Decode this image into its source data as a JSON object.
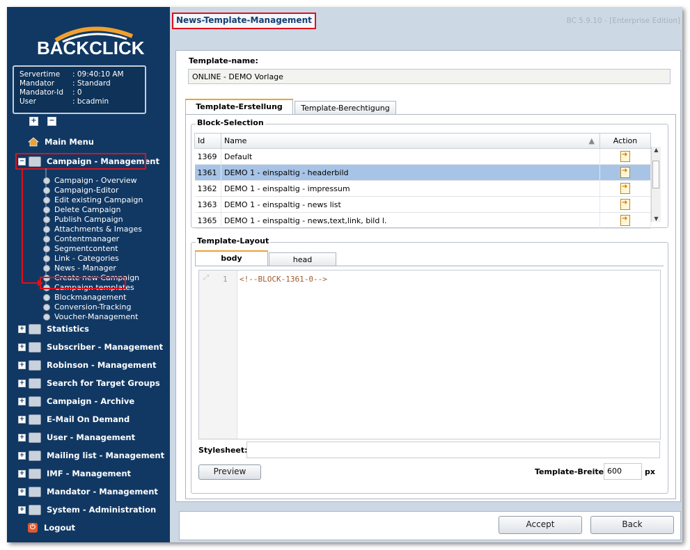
{
  "brand": {
    "name": "BACKCLICK"
  },
  "info": {
    "rows": [
      {
        "label": "Servertime",
        "value": ": 09:40:10 AM"
      },
      {
        "label": "Mandator",
        "value": ": Standard"
      },
      {
        "label": "Mandator-Id",
        "value": ": 0"
      },
      {
        "label": "User",
        "value": ": bcadmin"
      }
    ]
  },
  "tree_controls": {
    "expand": "+",
    "collapse": "−"
  },
  "menu": {
    "main_menu": "Main Menu",
    "campaign_management": "Campaign - Management",
    "sub_items": [
      "Campaign - Overview",
      "Campaign-Editor",
      "Edit existing Campaign",
      "Delete Campaign",
      "Publish Campaign",
      "Attachments & Images",
      "Contentmanager",
      "Segmentcontent",
      "Link - Categories",
      "News - Manager",
      "Create new Campaign",
      "Campaign templates",
      "Blockmanagement",
      "Conversion-Tracking",
      "Voucher-Management"
    ],
    "sections": [
      "Statistics",
      "Subscriber - Management",
      "Robinson - Management",
      "Search for Target Groups",
      "Campaign - Archive",
      "E-Mail On Demand",
      "User - Management",
      "Mailing list - Management",
      "IMF - Management",
      "Mandator - Management",
      "System - Administration"
    ],
    "logout": "Logout"
  },
  "header": {
    "title": "News-Template-Management",
    "version": "BC 5.9.10 - [Enterprise Edition]"
  },
  "template_name": {
    "legend": "Template-name:",
    "value": "ONLINE - DEMO  Vorlage"
  },
  "tabs": [
    "Template-Erstellung",
    "Template-Berechtigung"
  ],
  "block_selection": {
    "legend": "Block-Selection",
    "columns": [
      "Id",
      "Name",
      "Action"
    ],
    "rows": [
      {
        "id": "1369",
        "name": "Default"
      },
      {
        "id": "1361",
        "name": "DEMO 1 - einspaltig - headerbild"
      },
      {
        "id": "1362",
        "name": "DEMO 1 - einspaltig - impressum"
      },
      {
        "id": "1363",
        "name": "DEMO 1 - einspaltig - news list"
      },
      {
        "id": "1365",
        "name": "DEMO 1 - einspaltig - news,text,link, bild l."
      }
    ]
  },
  "layout": {
    "legend": "Template-Layout",
    "tabs": [
      "body",
      "head"
    ],
    "line_number": "1",
    "code": "<!--BLOCK-1361-0-->",
    "stylesheet_label": "Stylesheet:",
    "stylesheet_value": "",
    "preview_label": "Preview",
    "width_label": "Template-Breite:",
    "width_value": "600",
    "width_unit": "px"
  },
  "footer": {
    "accept": "Accept",
    "back": "Back"
  },
  "colors": {
    "sidebar": "#113863",
    "highlight": "#e0101b",
    "selected_row": "#a7c4e6",
    "tab_accent": "#f0a030"
  }
}
